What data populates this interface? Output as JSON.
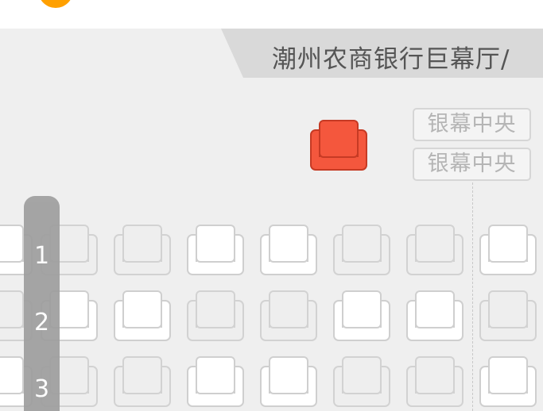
{
  "hall": {
    "name": "潮州农商银行巨幕厅/"
  },
  "screen": {
    "labels": [
      "银幕中央",
      "银幕中央"
    ]
  },
  "colors": {
    "accent": "#ffa000",
    "selected": "#f4573d",
    "available": "#ffffff",
    "sold": "#eeeeee",
    "rail": "#9e9e9e"
  },
  "rows": [
    {
      "number": "1",
      "seats": [
        "available",
        "sold",
        "sold",
        "available",
        "available",
        "sold",
        "sold",
        "available"
      ]
    },
    {
      "number": "2",
      "seats": [
        "sold",
        "available",
        "available",
        "sold",
        "sold",
        "available",
        "available",
        "sold"
      ]
    },
    {
      "number": "3",
      "seats": [
        "available",
        "sold",
        "sold",
        "available",
        "available",
        "sold",
        "sold",
        "available"
      ]
    }
  ],
  "legend_seat": "selected"
}
